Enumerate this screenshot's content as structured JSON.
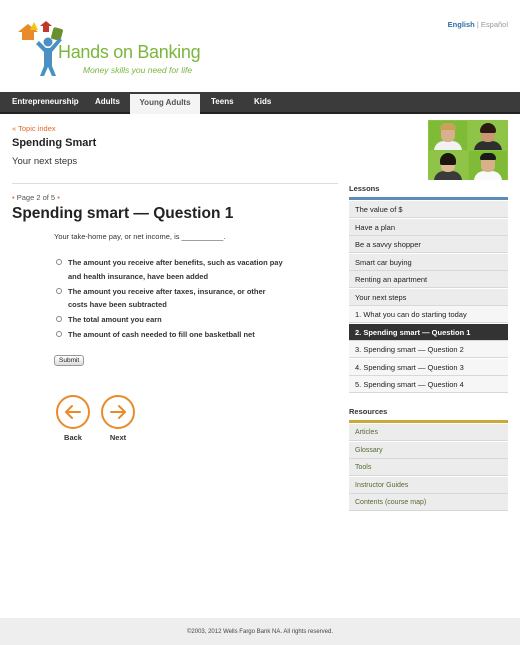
{
  "header": {
    "lang_english": "English",
    "lang_sep": "|",
    "lang_espanol": "Español",
    "logo_title": "Hands on Banking",
    "logo_tagline": "Money skills you need for life"
  },
  "nav": {
    "items": [
      {
        "label": "Entrepreneurship"
      },
      {
        "label": "Adults"
      },
      {
        "label": "Young Adults",
        "active": true
      },
      {
        "label": "Teens"
      },
      {
        "label": "Kids"
      }
    ]
  },
  "topic": {
    "back_link": "« Topic index",
    "title": "Spending Smart",
    "subtitle": "Your next steps"
  },
  "question": {
    "page_label": "Page 2 of 5",
    "page_dot_left": "•",
    "page_dot_right": "•",
    "title": "Spending smart — Question 1",
    "prompt": "Your take-home pay, or net income, is __________.",
    "options": [
      "The amount you receive after benefits, such as vacation pay and health insurance, have been added",
      "The amount you receive after taxes, insurance, or other costs have been subtracted",
      "The total amount you earn",
      "The amount of cash needed to fill one basketball net"
    ],
    "submit_label": "Submit",
    "back_label": "Back",
    "next_label": "Next"
  },
  "sidebar": {
    "lessons_heading": "Lessons",
    "lessons": [
      {
        "label": "The value of $"
      },
      {
        "label": "Have a plan"
      },
      {
        "label": "Be a savvy shopper"
      },
      {
        "label": "Smart car buying"
      },
      {
        "label": "Renting an apartment"
      },
      {
        "label": "Your next steps"
      },
      {
        "label": "1. What you can do starting today",
        "sub": true
      },
      {
        "label": "2. Spending smart — Question 1",
        "current": true
      },
      {
        "label": "3. Spending smart — Question 2",
        "sub": true
      },
      {
        "label": "4. Spending smart — Question 3",
        "sub": true
      },
      {
        "label": "5. Spending smart — Question 4",
        "sub": true
      }
    ],
    "resources_heading": "Resources",
    "resources": [
      {
        "label": "Articles"
      },
      {
        "label": "Glossary"
      },
      {
        "label": "Tools"
      },
      {
        "label": "Instructor Guides"
      },
      {
        "label": "Contents (course map)"
      }
    ]
  },
  "footer": {
    "copyright": "©2003, 2012 Wells Fargo Bank NA. All rights reserved."
  },
  "colors": {
    "brand_green": "#7ab63b",
    "accent_orange": "#e0692a",
    "lessons_bar": "#5b8db8",
    "resources_bar": "#c9a93a",
    "nav_bg": "#3b3b3b"
  }
}
